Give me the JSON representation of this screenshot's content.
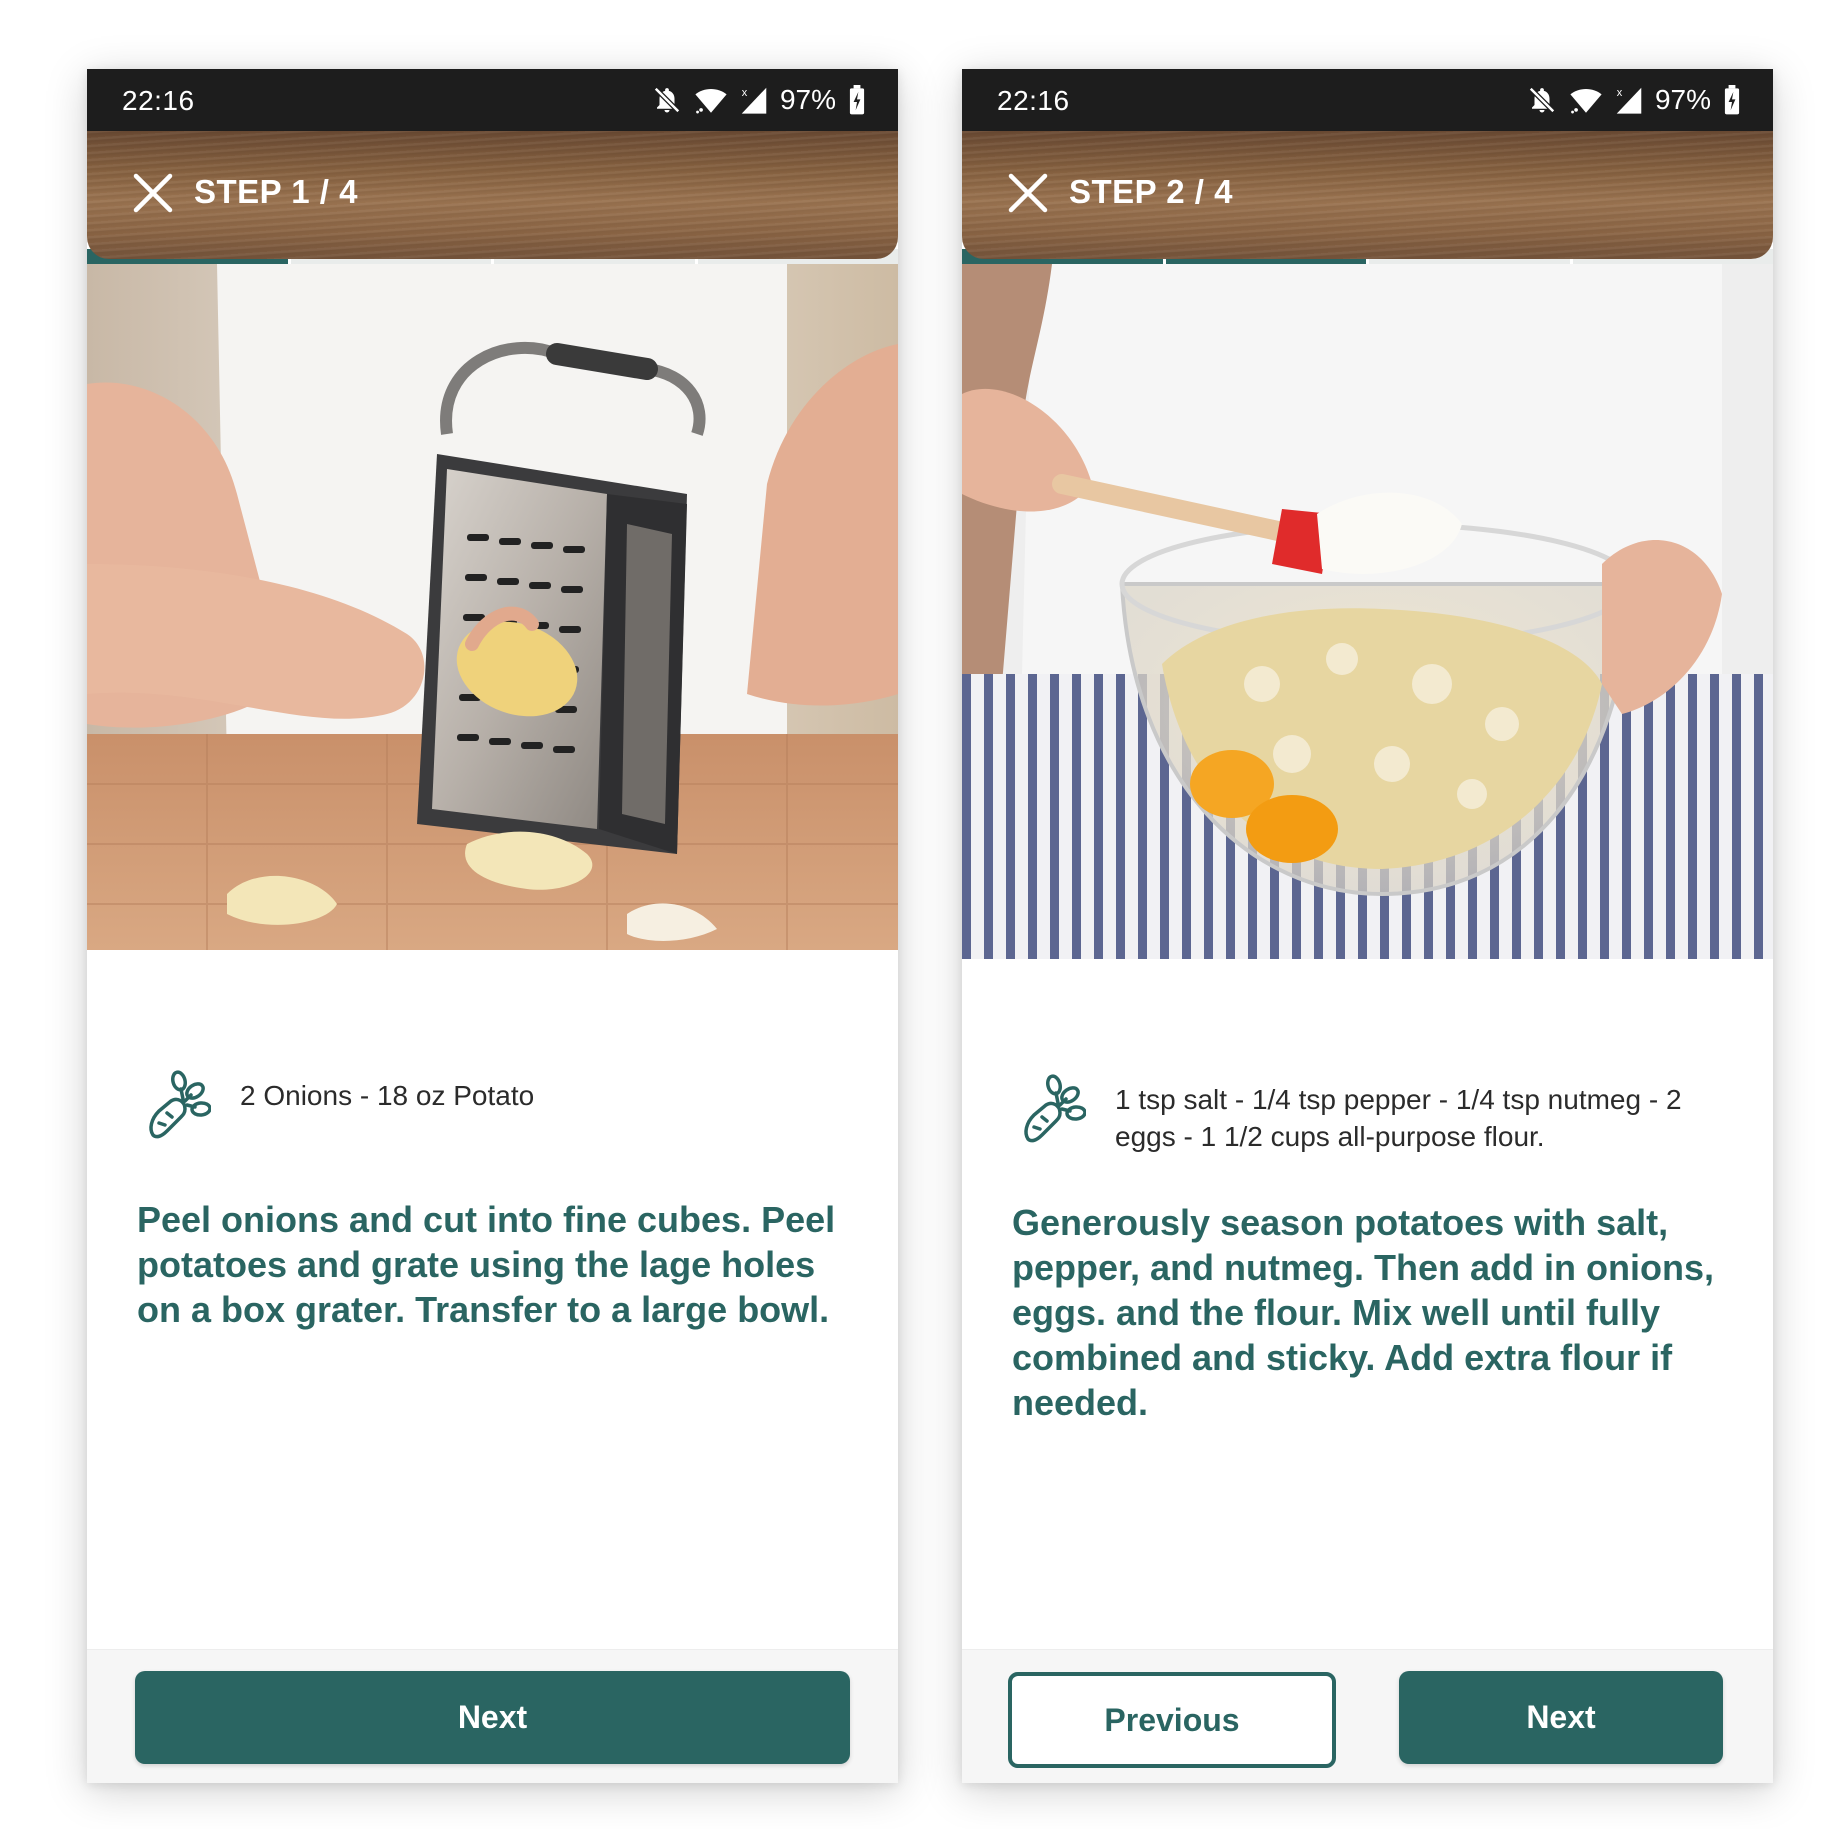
{
  "screens": [
    {
      "status": {
        "time": "22:16",
        "battery": "97%"
      },
      "header": {
        "step_label": "STEP 1 / 4"
      },
      "progress": {
        "current": 1,
        "total": 4
      },
      "ingredients": "2 Onions - 18 oz Potato",
      "instruction": "Peel onions and cut into fine cubes. Peel potatoes and grate using the lage holes on a box grater. Transfer to a large bowl.",
      "buttons": {
        "next": "Next"
      }
    },
    {
      "status": {
        "time": "22:16",
        "battery": "97%"
      },
      "header": {
        "step_label": "STEP 2 / 4"
      },
      "progress": {
        "current": 2,
        "total": 4
      },
      "ingredients": "1 tsp salt - 1/4 tsp pepper - 1/4 tsp nutmeg - 2 eggs - 1 1/2 cups all-purpose flour.",
      "instruction": "Generously season potatoes with salt, pepper, and nutmeg. Then add in onions, eggs. and the flour. Mix well until fully combined and sticky. Add extra flour if needed.",
      "buttons": {
        "previous": "Previous",
        "next": "Next"
      }
    }
  ],
  "icons": {
    "close": "close-icon",
    "ingredients": "carrot-icon",
    "mute": "bell-off-icon",
    "wifi": "wifi-icon",
    "signal": "cell-signal-icon",
    "battery": "battery-charging-icon"
  },
  "colors": {
    "accent": "#2a6562",
    "status_bar": "#1d1d1d",
    "text": "#2b2b2b"
  }
}
